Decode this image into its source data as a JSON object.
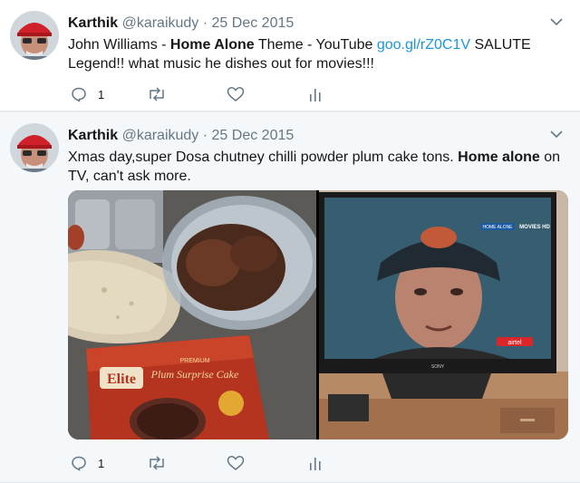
{
  "tweets": [
    {
      "name": "Karthik",
      "handle": "@karaikudy",
      "separator": "·",
      "date": "25 Dec 2015",
      "text_parts": {
        "p1": "John Williams - ",
        "bold1": "Home Alone",
        "p2": " Theme - YouTube ",
        "link": "goo.gl/rZ0C1V",
        "p3": " SALUTE Legend!! what music he dishes out for movies!!!"
      },
      "reply_count": "1"
    },
    {
      "name": "Karthik",
      "handle": "@karaikudy",
      "separator": "·",
      "date": "25 Dec 2015",
      "text_parts": {
        "p1": "Xmas day,super Dosa chutney chilli powder plum cake tons. ",
        "bold1": "Home alone",
        "p2": " on TV, can't ask more."
      },
      "reply_count": "1",
      "photo_left": {
        "cake_brand": "Elite",
        "cake_line": "PREMIUM",
        "cake_name": "Plum Surprise Cake"
      },
      "photo_right": {
        "channel": "HOME ALONE",
        "network": "MOVIES HD",
        "sponsor": "airtel",
        "tv_brand": "SONY"
      }
    }
  ],
  "icons": [
    "chevron-down-icon",
    "reply-icon",
    "retweet-icon",
    "like-icon",
    "analytics-icon"
  ],
  "colors": {
    "link": "#1b95e0",
    "muted": "#657786",
    "text": "#14171a",
    "divider": "#e1e8ed"
  }
}
